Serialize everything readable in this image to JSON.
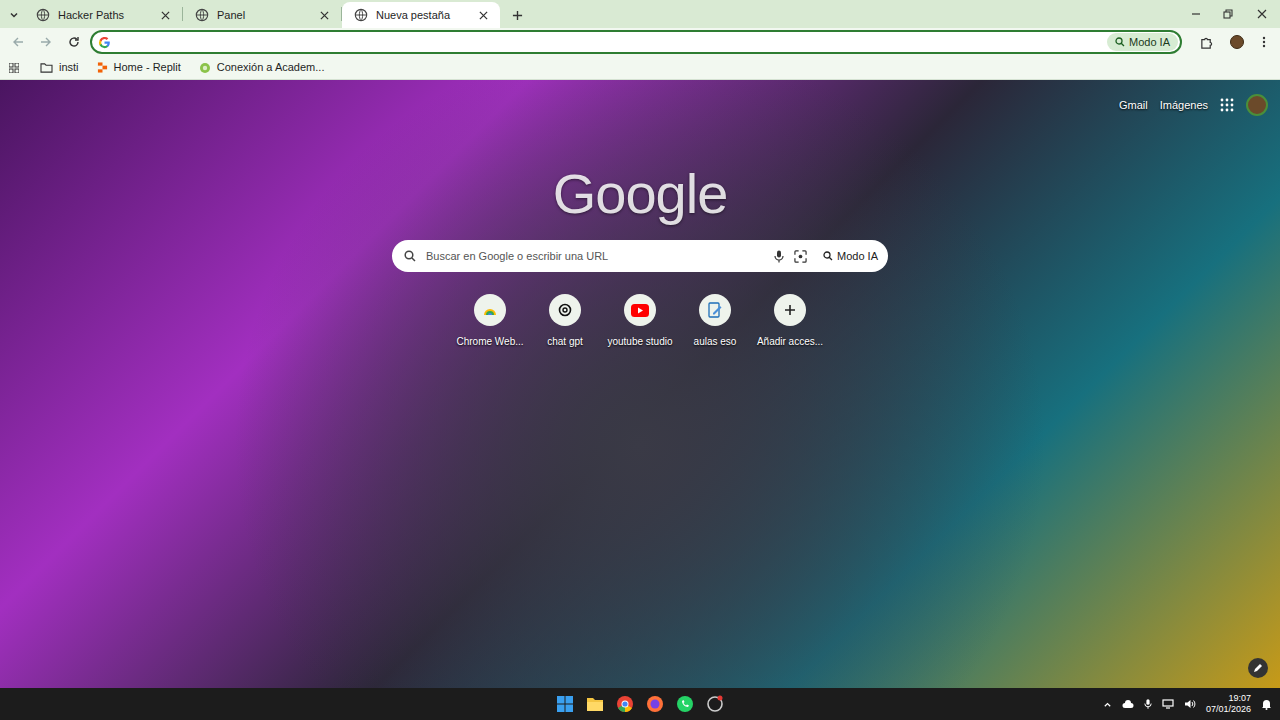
{
  "tabs": [
    {
      "label": "Hacker Paths",
      "selected": false
    },
    {
      "label": "Panel",
      "selected": false
    },
    {
      "label": "Nueva pestaña",
      "selected": true
    }
  ],
  "address_bar": {
    "value": "",
    "mode_button": "Modo IA"
  },
  "bookmarks": [
    {
      "label": "insti",
      "kind": "folder"
    },
    {
      "label": "Home - Replit",
      "kind": "replit"
    },
    {
      "label": "Conexión a Academ...",
      "kind": "site"
    }
  ],
  "header_links": [
    "Gmail",
    "Imágenes"
  ],
  "logo": "Google",
  "search": {
    "placeholder": "Buscar en Google o escribir una URL",
    "mode_button": "Modo IA"
  },
  "shortcuts": [
    {
      "label": "Chrome Web...",
      "kind": "webstore"
    },
    {
      "label": "chat gpt",
      "kind": "chatgpt"
    },
    {
      "label": "youtube studio",
      "kind": "youtube"
    },
    {
      "label": "aulas eso",
      "kind": "aulas"
    },
    {
      "label": "Añadir acces...",
      "kind": "add"
    }
  ],
  "taskbar": {
    "time": "19:07",
    "date": "07/01/2026"
  }
}
